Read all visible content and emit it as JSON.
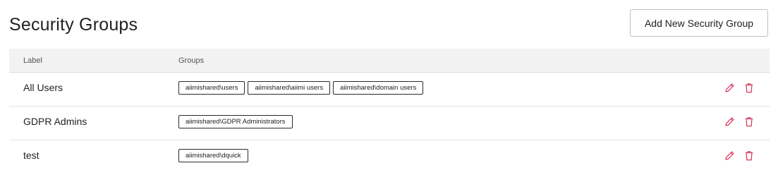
{
  "page": {
    "title": "Security Groups",
    "add_button_label": "Add New Security Group"
  },
  "table": {
    "headers": {
      "label": "Label",
      "groups": "Groups"
    },
    "rows": [
      {
        "label": "All Users",
        "groups": [
          "aiimishared\\users",
          "aiimishared\\aiimi users",
          "aiimishared\\domain users"
        ]
      },
      {
        "label": "GDPR Admins",
        "groups": [
          "aiimishared\\GDPR Administrators"
        ]
      },
      {
        "label": "test",
        "groups": [
          "aiimishared\\dquick"
        ]
      }
    ]
  },
  "icons": {
    "edit": "pencil-icon",
    "delete": "trash-icon"
  },
  "colors": {
    "action_icon": "#d9345a",
    "header_bg": "#f2f2f2",
    "tag_border": "#2b2b2b"
  }
}
